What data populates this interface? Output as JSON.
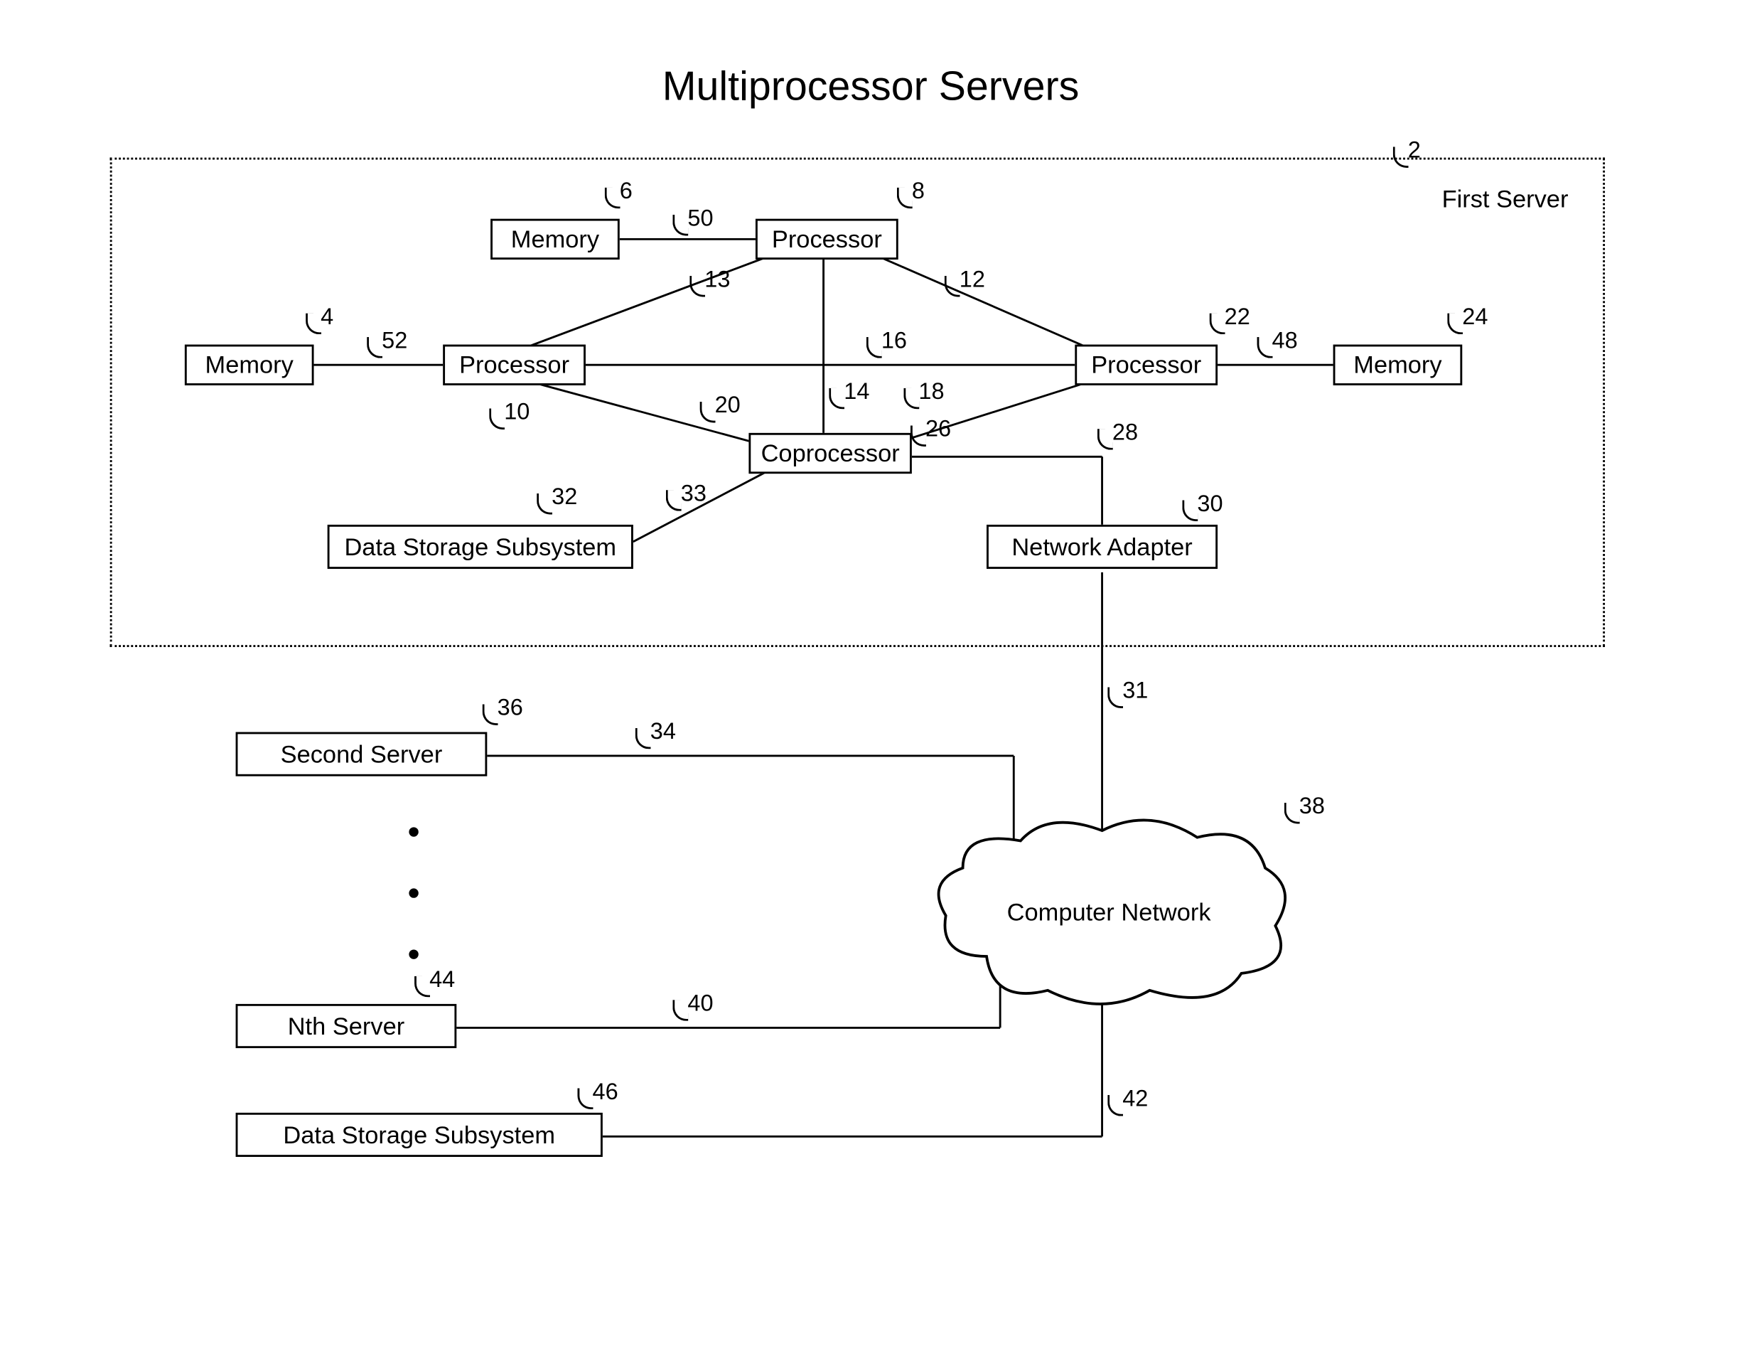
{
  "title": "Multiprocessor Servers",
  "first_server_label": "First Server",
  "boxes": {
    "memory_6": "Memory",
    "processor_8": "Processor",
    "memory_4": "Memory",
    "processor_10": "Processor",
    "processor_22": "Processor",
    "memory_24": "Memory",
    "coprocessor_26": "Coprocessor",
    "dss_32": "Data Storage Subsystem",
    "network_adapter_30": "Network Adapter",
    "second_server_36": "Second Server",
    "nth_server_44": "Nth Server",
    "dss_46": "Data Storage Subsystem"
  },
  "cloud": "Computer Network",
  "refs": {
    "r2": "2",
    "r4": "4",
    "r6": "6",
    "r8": "8",
    "r10": "10",
    "r12": "12",
    "r13": "13",
    "r14": "14",
    "r16": "16",
    "r18": "18",
    "r20": "20",
    "r22": "22",
    "r24": "24",
    "r26": "26",
    "r28": "28",
    "r30": "30",
    "r31": "31",
    "r32": "32",
    "r33": "33",
    "r34": "34",
    "r36": "36",
    "r38": "38",
    "r40": "40",
    "r42": "42",
    "r44": "44",
    "r46": "46",
    "r48": "48",
    "r50": "50",
    "r52": "52"
  }
}
